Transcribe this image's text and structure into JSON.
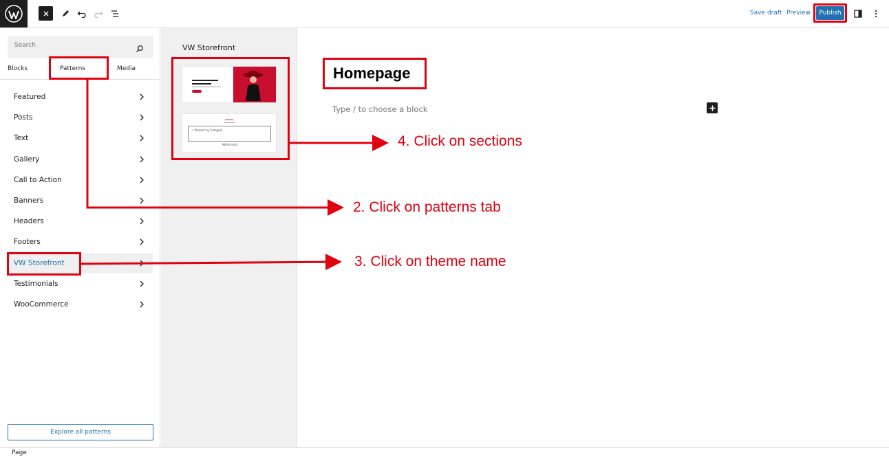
{
  "toolbar": {
    "save_draft_label": "Save draft",
    "preview_label": "Preview",
    "publish_label": "Publish"
  },
  "inserter": {
    "search_placeholder": "Search",
    "tabs": [
      {
        "label": "Blocks"
      },
      {
        "label": "Patterns"
      },
      {
        "label": "Media"
      }
    ],
    "categories": [
      {
        "label": "Featured"
      },
      {
        "label": "Posts"
      },
      {
        "label": "Text"
      },
      {
        "label": "Gallery"
      },
      {
        "label": "Call to Action"
      },
      {
        "label": "Banners"
      },
      {
        "label": "Headers"
      },
      {
        "label": "Footers"
      },
      {
        "label": "VW Storefront"
      },
      {
        "label": "Testimonials"
      },
      {
        "label": "WooCommerce"
      }
    ],
    "explore_label": "Explore all patterns"
  },
  "pattern_preview": {
    "title": "VW Storefront",
    "thumb2_category_label": "< Product by Category",
    "thumb2_write_label": "Write info"
  },
  "canvas": {
    "page_title": "Homepage",
    "block_placeholder": "Type / to choose a block"
  },
  "annotations": {
    "step2": "2. Click on patterns tab",
    "step3": "3. Click on theme name",
    "step4": "4. Click on sections"
  },
  "statusbar": {
    "label": "Page"
  },
  "colors": {
    "accent": "#2271b1",
    "annotation_red": "#e0000f",
    "dark": "#1e1e1e",
    "theme_red": "#c8102e"
  }
}
